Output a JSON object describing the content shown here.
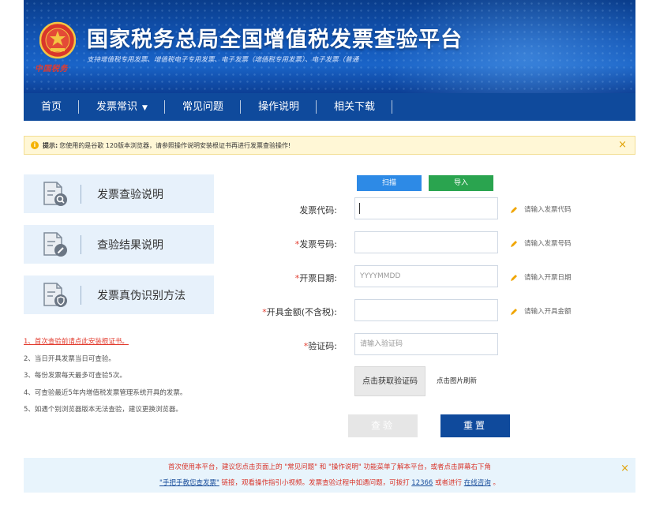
{
  "header": {
    "title": "国家税务总局全国增值税发票查验平台",
    "subtitle": "支持增值税专用发票、增值税电子专用发票、电子发票（增值税专用发票）、电子发票（普通",
    "emblem_caption": "中国税务"
  },
  "nav": {
    "items": [
      {
        "label": "首页"
      },
      {
        "label": "发票常识"
      },
      {
        "label": "常见问题"
      },
      {
        "label": "操作说明"
      },
      {
        "label": "相关下载"
      }
    ]
  },
  "notice": {
    "label": "提示:",
    "text": "您使用的是谷歌 120版本浏览器，请参照操作说明安装根证书再进行发票查验操作!",
    "close": "×"
  },
  "sidebar": {
    "cards": [
      {
        "label": "发票查验说明",
        "icon": "search-document-icon"
      },
      {
        "label": "查验结果说明",
        "icon": "edit-document-icon"
      },
      {
        "label": "发票真伪识别方法",
        "icon": "shield-document-icon"
      }
    ],
    "tip1": "1、首次查验前请点此安装根证书。",
    "tip2": "2、当日开具发票当日可查验。",
    "tip3": "3、每份发票每天最多可查验5次。",
    "tip4": "4、可查验最近5年内增值税发票管理系统开具的发票。",
    "tip5": "5、如遇个别浏览器版本无法查验，建议更换浏览器。"
  },
  "form": {
    "scan_label": "扫描",
    "import_label": "导入",
    "fields": [
      {
        "label": "发票代码:",
        "required": "",
        "placeholder": "",
        "hint": "请输入发票代码"
      },
      {
        "label": "发票号码:",
        "required": "*",
        "placeholder": "",
        "hint": "请输入发票号码"
      },
      {
        "label": "开票日期:",
        "required": "*",
        "placeholder": "YYYYMMDD",
        "hint": "请输入开票日期"
      },
      {
        "label": "开具金额(不含税):",
        "required": "*",
        "placeholder": "",
        "hint": "请输入开具金额"
      },
      {
        "label": "验证码:",
        "required": "*",
        "placeholder": "请输入验证码",
        "hint": ""
      }
    ],
    "captcha_text": "点击获取验证码",
    "captcha_hint": "点击图片刷新",
    "query_label": "查验",
    "reset_label": "重置"
  },
  "bottom": {
    "line1": "首次使用本平台，建议您点击页面上的 \"常见问题\" 和 \"操作说明\" 功能菜单了解本平台，或者点击屏幕右下角",
    "link_tutorial": "\"手把手教您查发票\"",
    "line2_mid": " 链接，观看操作指引小视频。发票查验过程中如遇问题，可拨打 ",
    "link_phone": "12366",
    "line2_or": " 或者进行 ",
    "link_consult": "在线咨询",
    "line2_end": " 。",
    "close": "×"
  },
  "colors": {
    "nav_bg": "#0f4a9c",
    "scan_btn": "#2d8ae6",
    "import_btn": "#2aa44f",
    "required_star": "#e23b2e"
  }
}
